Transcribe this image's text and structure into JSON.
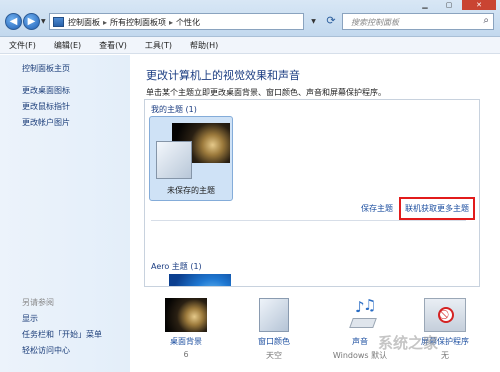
{
  "window": {
    "minimize_icon": "minimize-icon",
    "maximize_icon": "maximize-icon",
    "close_icon": "close-icon"
  },
  "address_bar": {
    "back_icon": "back-arrow-icon",
    "forward_icon": "forward-arrow-icon",
    "breadcrumbs": [
      "控制面板",
      "所有控制面板项",
      "个性化"
    ],
    "separator": "▸",
    "search_placeholder": "搜索控制面板"
  },
  "menu": [
    "文件(F)",
    "编辑(E)",
    "查看(V)",
    "工具(T)",
    "帮助(H)"
  ],
  "left_pane": {
    "home": "控制面板主页",
    "links": [
      "更改桌面图标",
      "更改鼠标指针",
      "更改帐户图片"
    ],
    "see_also_title": "另请参阅",
    "see_also": [
      "显示",
      "任务栏和「开始」菜单",
      "轻松访问中心"
    ]
  },
  "main": {
    "title": "更改计算机上的视觉效果和声音",
    "subtitle": "单击某个主题立即更改桌面背景、窗口颜色、声音和屏幕保护程序。",
    "my_themes_label": "我的主题 (1)",
    "unsaved_theme_label": "未保存的主题",
    "save_theme_link": "保存主题",
    "online_themes_link": "联机获取更多主题",
    "aero_label": "Aero 主题 (1)"
  },
  "bottom": [
    {
      "label": "桌面背景",
      "value": "6",
      "icon": "desktop-background-icon"
    },
    {
      "label": "窗口颜色",
      "value": "天空",
      "icon": "window-color-icon"
    },
    {
      "label": "声音",
      "value": "Windows 默认",
      "icon": "sounds-icon"
    },
    {
      "label": "屏幕保护程序",
      "value": "无",
      "icon": "screensaver-icon"
    }
  ],
  "watermark": "系统之家"
}
